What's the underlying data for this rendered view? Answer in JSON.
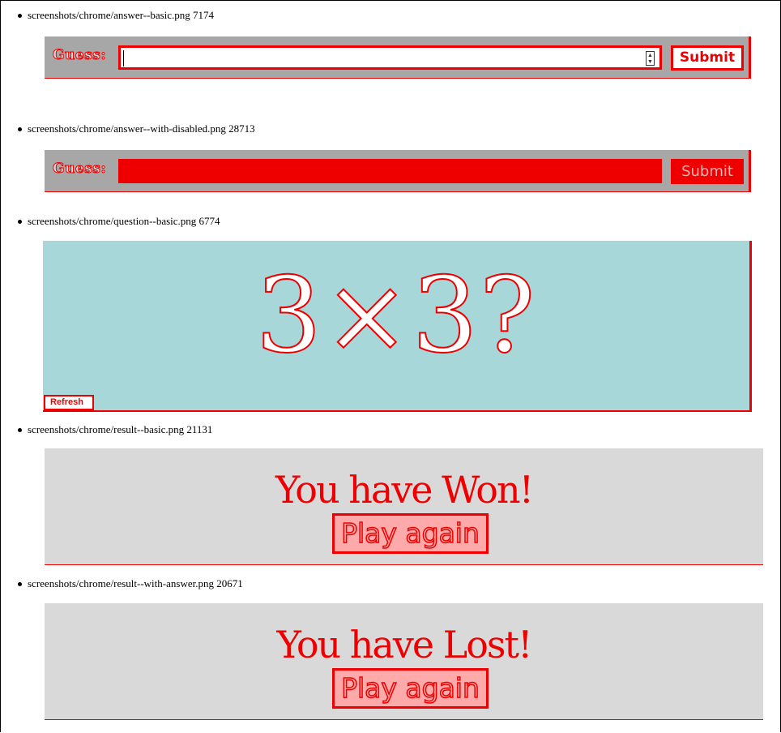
{
  "captions": [
    "screenshots/chrome/answer--basic.png 7174",
    "screenshots/chrome/answer--with-disabled.png 28713",
    "screenshots/chrome/question--basic.png 6774",
    "screenshots/chrome/result--basic.png 21131",
    "screenshots/chrome/result--with-answer.png 20671"
  ],
  "answer_basic": {
    "label": "Guess:",
    "value": "",
    "submit_label": "Submit"
  },
  "answer_disabled": {
    "label": "Guess:",
    "value": "",
    "submit_label": "Submit"
  },
  "question": {
    "text": "3×3?",
    "refresh_label": "Refresh"
  },
  "result_won": {
    "title": "You have Won!",
    "play_again_label": "Play again"
  },
  "result_lost": {
    "title": "You have Lost!",
    "play_again_label": "Play again"
  },
  "colors": {
    "accent": "#ee0000",
    "panel_gray": "#a7a7a7",
    "question_bg": "#a8d7da",
    "result_bg": "#d9d9d9"
  }
}
